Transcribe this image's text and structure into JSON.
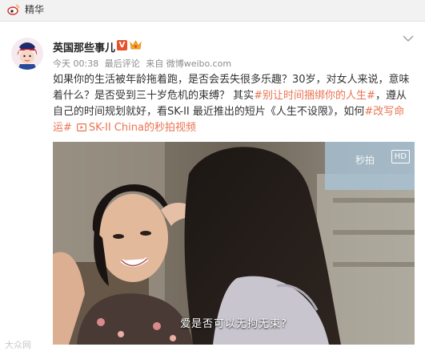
{
  "header": {
    "title": "精华",
    "icon": "weibo-logo-icon"
  },
  "post": {
    "author": "英国那些事儿",
    "verified_badge": "V",
    "meta": {
      "date": "今天 00:38",
      "reply_tag": "最后评论",
      "source": "来自 微博weibo.com"
    },
    "text_before_tag": "如果你的生活被年龄拖着跑，是否会丢失很多乐趣？30岁，对女人来说，意味着什么？是否受到三十岁危机的束缚？ 其实",
    "tag1": "#别让时间捆绑你的人生#",
    "text_middle": "，遵从自己的时间规划就好，看SK-II 最近推出的短片《人生不设限》，如何",
    "tag2": "#改写命运#",
    "video_link": "SK-II China的秒拍视频",
    "video": {
      "subtitle": "爱是否可以无拘无束?",
      "watermark": "秒拍",
      "hd_badge": "HD"
    }
  },
  "page_watermark": "大众网",
  "colors": {
    "accent": "#eb7350",
    "header_bg": "#f2f2f2",
    "text": "#333333"
  }
}
